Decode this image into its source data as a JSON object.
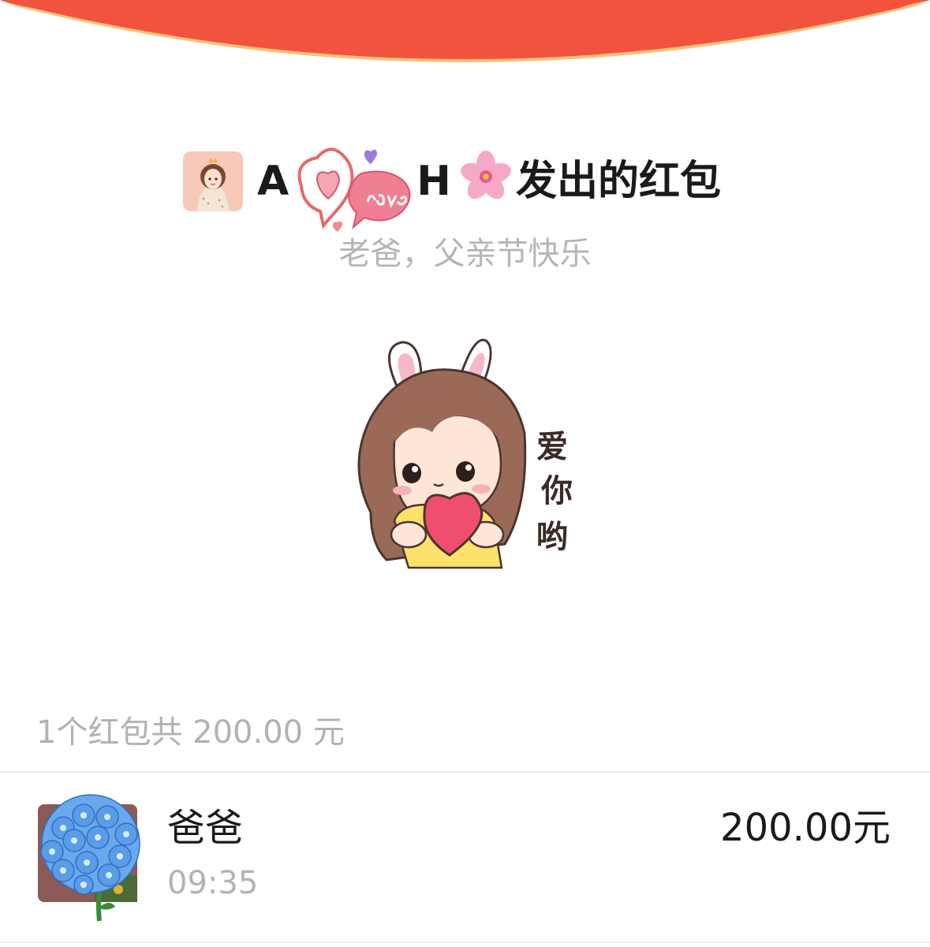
{
  "header": {
    "colors": {
      "cap_red": "#f1533f",
      "cap_rim": "#f3c27a"
    }
  },
  "sender": {
    "avatar_icon": "girl-with-crown-avatar",
    "name_start": "A",
    "name_end": "H",
    "suffix": "发出的红包",
    "decorations": [
      "love-heart-sticker-icon",
      "cherry-blossom-icon"
    ]
  },
  "greeting": "老爸，父亲节快乐",
  "sticker": {
    "icon": "bunny-ears-girl-holding-heart-sticker",
    "text": [
      "爱",
      "你",
      "哟"
    ]
  },
  "summary": "1个红包共 200.00 元",
  "receivers": [
    {
      "avatar_icon": "blue-hydrangea-avatar",
      "name": "爸爸",
      "time": "09:35",
      "amount": "200.00元"
    }
  ]
}
